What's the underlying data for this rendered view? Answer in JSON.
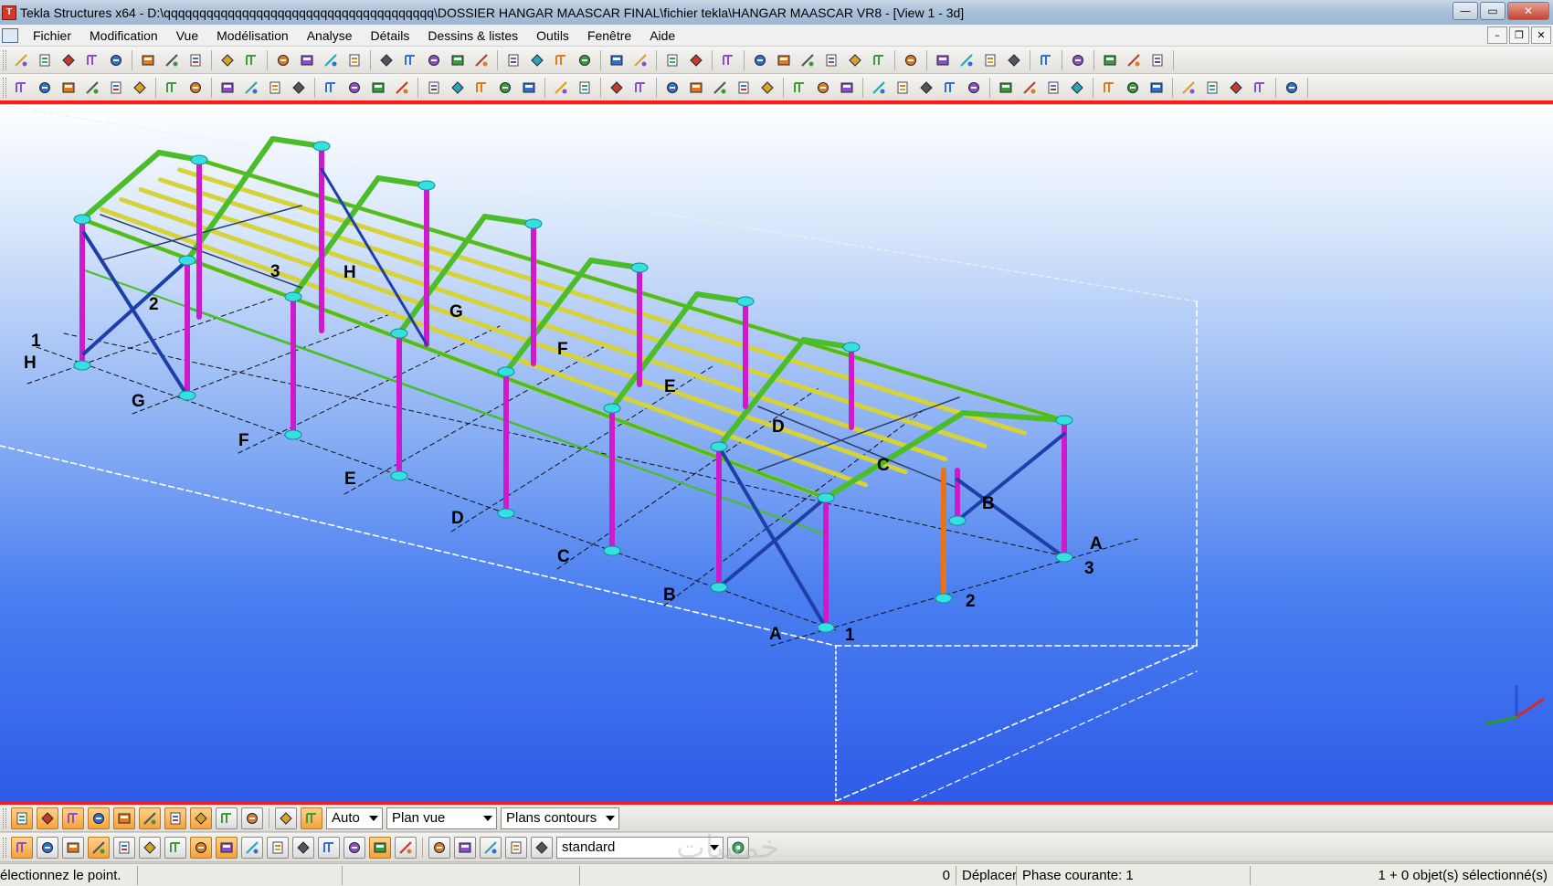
{
  "window": {
    "title": "Tekla Structures x64 - D:\\qqqqqqqqqqqqqqqqqqqqqqqqqqqqqqqqqqqqqq\\DOSSIER HANGAR MAASCAR FINAL\\fichier tekla\\HANGAR MAASCAR VR8  - [View 1 - 3d]",
    "controls": {
      "minimize": "—",
      "maximize": "▭",
      "close": "✕"
    },
    "mdi_controls": {
      "minimize": "–",
      "restore": "❐",
      "close": "✕"
    }
  },
  "menu": {
    "items": [
      {
        "label": "Fichier"
      },
      {
        "label": "Modification"
      },
      {
        "label": "Vue"
      },
      {
        "label": "Modélisation"
      },
      {
        "label": "Analyse"
      },
      {
        "label": "Détails"
      },
      {
        "label": "Dessins & listes"
      },
      {
        "label": "Outils"
      },
      {
        "label": "Fenêtre"
      },
      {
        "label": "Aide"
      }
    ]
  },
  "toolbar1": {
    "groups": [
      [
        "view-icon",
        "view-icon",
        "view-icon",
        "view-icon",
        "view-icon"
      ],
      [
        "new-icon",
        "open-icon",
        "save-icon"
      ],
      [
        "undo-icon",
        "redo-icon"
      ],
      [
        "copy-icon",
        "move-icon",
        "paste-icon",
        "mirror-icon"
      ],
      [
        "window-icon",
        "window-icon",
        "window-icon",
        "cut-icon",
        "select-icon"
      ],
      [
        "part-icon",
        "part-icon",
        "part-icon",
        "part-icon"
      ],
      [
        "connect-icon",
        "connect-icon"
      ],
      [
        "component-icon",
        "component-icon"
      ],
      [
        "help-icon"
      ],
      [
        "grid-icon",
        "grid-icon",
        "grid-icon",
        "grid-icon",
        "grid-icon",
        "grid-icon"
      ],
      [
        "pin-icon"
      ],
      [
        "drawing-icon",
        "drawing-icon",
        "drawing-icon",
        "drawing-icon"
      ],
      [
        "report-icon"
      ],
      [
        "tool-icon"
      ],
      [
        "forward-icon",
        "folder-icon",
        "tool-icon"
      ]
    ]
  },
  "toolbar2": {
    "groups": [
      [
        "snap-icon",
        "snap-icon",
        "snap-icon",
        "snap-icon",
        "snap-icon",
        "snap-icon"
      ],
      [
        "snap-icon",
        "target-icon"
      ],
      [
        "binocular-icon",
        "beam-icon",
        "component-icon",
        "box-icon"
      ],
      [
        "column-icon",
        "column-icon",
        "column-icon",
        "column-icon"
      ],
      [
        "beam-icon",
        "beam-icon",
        "beam-icon",
        "beam-icon",
        "beam-icon"
      ],
      [
        "bolt-icon",
        "weld-icon"
      ],
      [
        "plate-icon",
        "plate-icon"
      ],
      [
        "line-icon",
        "line-icon",
        "line-icon",
        "line-icon",
        "line-icon"
      ],
      [
        "fitting-icon",
        "fitting-icon",
        "fitting-icon"
      ],
      [
        "filter-icon",
        "filter-icon",
        "filter-icon",
        "filter-icon",
        "filter-icon"
      ],
      [
        "view-icon",
        "view-icon",
        "view-icon",
        "view-icon"
      ],
      [
        "view-icon",
        "view-icon",
        "view-icon"
      ],
      [
        "view-icon",
        "view-icon",
        "view-icon",
        "view-icon"
      ],
      [
        "export-icon"
      ]
    ]
  },
  "viewport": {
    "axis_labels": [
      {
        "text": "1"
      },
      {
        "text": "H"
      },
      {
        "text": "2"
      },
      {
        "text": "3"
      },
      {
        "text": "H"
      },
      {
        "text": "G"
      },
      {
        "text": "G"
      },
      {
        "text": "F"
      },
      {
        "text": "F"
      },
      {
        "text": "E"
      },
      {
        "text": "E"
      },
      {
        "text": "D"
      },
      {
        "text": "D"
      },
      {
        "text": "C"
      },
      {
        "text": "C"
      },
      {
        "text": "B"
      },
      {
        "text": "B"
      },
      {
        "text": "A"
      },
      {
        "text": "A"
      },
      {
        "text": "1"
      },
      {
        "text": "2"
      },
      {
        "text": "3"
      }
    ]
  },
  "bottom_bar1": {
    "buttons": [
      "snap-icon",
      "snap-icon",
      "snap-icon",
      "snap-icon",
      "snap-icon",
      "snap-icon",
      "snap-icon",
      "snap-icon",
      "snap-icon",
      "arrow-icon"
    ],
    "buttons2": [
      "box-icon",
      "box-icon"
    ],
    "selects": [
      {
        "value": "Auto"
      },
      {
        "value": "Plan vue"
      },
      {
        "value": "Plans contours"
      }
    ]
  },
  "bottom_bar2": {
    "buttons": [
      "select-icon",
      "select-icon",
      "select-icon",
      "select-icon",
      "select-icon",
      "select-icon",
      "select-icon",
      "select-icon",
      "select-icon",
      "select-icon",
      "select-icon",
      "select-icon",
      "select-icon",
      "select-icon",
      "select-icon",
      "select-icon"
    ],
    "buttons2": [
      "select-icon",
      "select-icon",
      "select-icon",
      "select-icon",
      "select-icon"
    ],
    "filter_select": {
      "value": "standard"
    },
    "watermark": "خمسات"
  },
  "status": {
    "prompt": "électionnez le point.",
    "coord": "0",
    "mode": "Déplacer",
    "phase": "Phase courante: 1",
    "selection": "1 + 0 objet(s) sélectionné(s)"
  },
  "colors": {
    "accent_red": "#ff1a1a",
    "viewport_top": "#ffffff",
    "viewport_bottom": "#2e5be8",
    "column": "#cc1acc",
    "brace": "#1f3fa8",
    "purlin": "#d6d23a",
    "rafter": "#4bbd2a",
    "node": "#37e0e0",
    "orange_column": "#e8721a"
  }
}
